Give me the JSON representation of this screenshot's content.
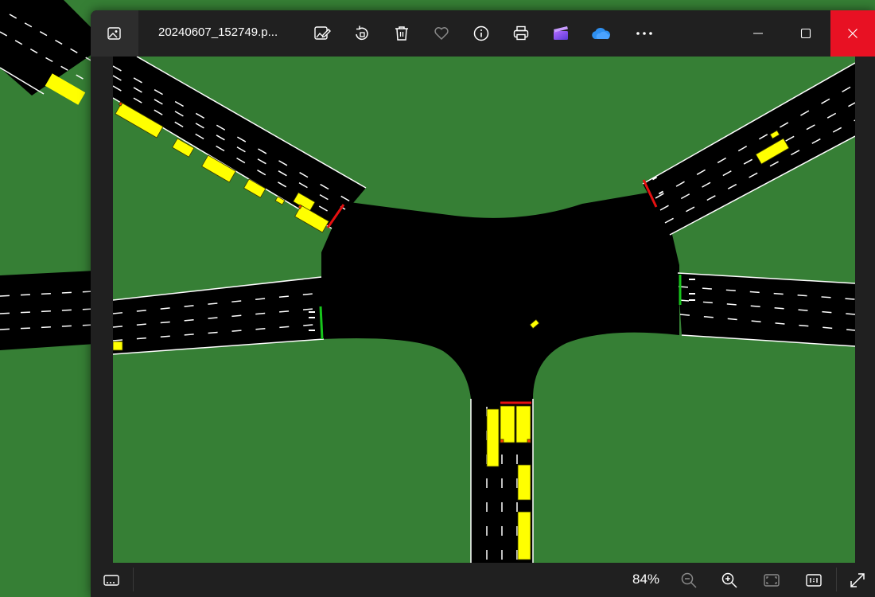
{
  "window": {
    "file_name": "20240607_152749.p...",
    "zoom_level": "84%"
  },
  "toolbar": {
    "buttons": [
      {
        "name": "edit-image-button",
        "icon": "edit-image-icon"
      },
      {
        "name": "rotate-button",
        "icon": "rotate-icon"
      },
      {
        "name": "delete-button",
        "icon": "trash-icon"
      },
      {
        "name": "favorite-button",
        "icon": "heart-icon"
      },
      {
        "name": "file-info-button",
        "icon": "info-icon"
      },
      {
        "name": "print-button",
        "icon": "printer-icon"
      },
      {
        "name": "clipchamp-button",
        "icon": "clipchamp-icon"
      },
      {
        "name": "onedrive-button",
        "icon": "cloud-icon"
      },
      {
        "name": "more-options-button",
        "icon": "more-icon"
      }
    ]
  },
  "window_controls": [
    "minimize-icon",
    "maximize-icon",
    "close-icon"
  ],
  "statusbar": {
    "buttons": [
      "filmstrip-icon",
      "zoom-out-icon",
      "zoom-in-icon",
      "fit-to-window-icon",
      "actual-size-icon",
      "fullscreen-icon"
    ]
  },
  "colors": {
    "grass": "#367f35",
    "road": "#000000",
    "lane_marking": "#ffffff",
    "vehicle": "#ffff00",
    "vehicle_brake_light": "#ff3c00",
    "signal_red": "#e51010",
    "signal_green": "#17c51c",
    "titlebar": "#202020",
    "close_button": "#e81123",
    "accent_icon": "#4ba3ff"
  }
}
